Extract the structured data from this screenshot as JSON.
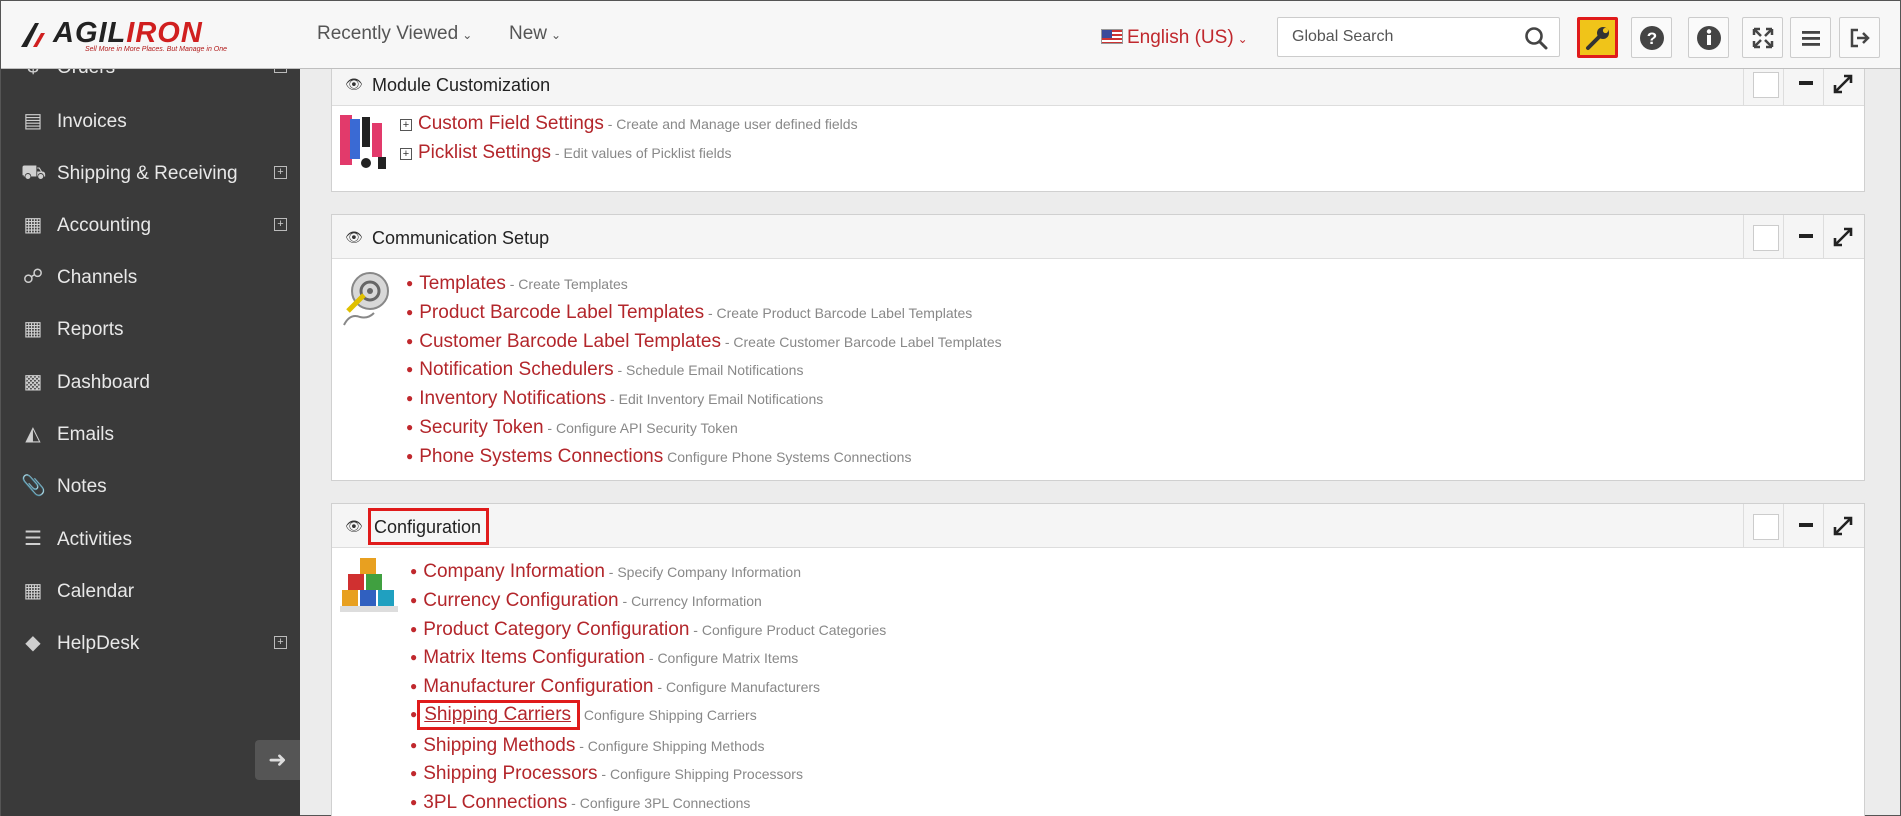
{
  "header": {
    "logo": {
      "word_black": "AGIL",
      "word_red": "IRON",
      "tagline": "Sell More in More Places. But Manage in One"
    },
    "nav": [
      {
        "label": "Recently Viewed"
      },
      {
        "label": "New"
      }
    ],
    "language": "English (US)",
    "search": {
      "placeholder": "Global Search",
      "value": ""
    },
    "toolbar_icons": [
      "wrench-icon",
      "help-icon",
      "info-icon",
      "fullscreen-icon",
      "menu-icon",
      "logout-icon"
    ],
    "active_icon": "wrench-icon"
  },
  "sidebar": {
    "items": [
      {
        "label": "Orders",
        "icon": "dollar-icon",
        "expandable": true
      },
      {
        "label": "Invoices",
        "icon": "document-icon",
        "expandable": false
      },
      {
        "label": "Shipping & Receiving",
        "icon": "truck-icon",
        "expandable": true
      },
      {
        "label": "Accounting",
        "icon": "book-icon",
        "expandable": true
      },
      {
        "label": "Channels",
        "icon": "channels-icon",
        "expandable": false
      },
      {
        "label": "Reports",
        "icon": "table-icon",
        "expandable": false
      },
      {
        "label": "Dashboard",
        "icon": "chart-icon",
        "expandable": false
      },
      {
        "label": "Emails",
        "icon": "inbox-icon",
        "expandable": false
      },
      {
        "label": "Notes",
        "icon": "paperclip-icon",
        "expandable": false
      },
      {
        "label": "Activities",
        "icon": "list-icon",
        "expandable": false
      },
      {
        "label": "Calendar",
        "icon": "calendar-icon",
        "expandable": false
      },
      {
        "label": "HelpDesk",
        "icon": "ticket-icon",
        "expandable": true
      }
    ],
    "plus_glyph": "+"
  },
  "panels": {
    "module_customization": {
      "title": "Module Customization",
      "items": [
        {
          "link": "Custom Field Settings",
          "desc": " - Create and Manage user defined fields"
        },
        {
          "link": "Picklist Settings",
          "desc": " - Edit values of Picklist fields"
        }
      ]
    },
    "communication_setup": {
      "title": "Communication Setup",
      "items": [
        {
          "link": "Templates",
          "desc": " - Create Templates"
        },
        {
          "link": "Product Barcode Label Templates",
          "desc": " - Create Product Barcode Label Templates"
        },
        {
          "link": "Customer Barcode Label Templates",
          "desc": " - Create Customer Barcode Label Templates"
        },
        {
          "link": "Notification Schedulers",
          "desc": " - Schedule Email Notifications"
        },
        {
          "link": "Inventory Notifications",
          "desc": " - Edit Inventory Email Notifications"
        },
        {
          "link": "Security Token",
          "desc": " - Configure API Security Token"
        },
        {
          "link": "Phone Systems Connections",
          "desc": " Configure Phone Systems Connections"
        }
      ]
    },
    "configuration": {
      "title": "Configuration",
      "items": [
        {
          "link": "Company Information",
          "desc": " - Specify Company Information"
        },
        {
          "link": "Currency Configuration",
          "desc": " - Currency Information"
        },
        {
          "link": "Product Category Configuration",
          "desc": " - Configure Product Categories"
        },
        {
          "link": "Matrix Items Configuration",
          "desc": " - Configure Matrix Items"
        },
        {
          "link": "Manufacturer Configuration",
          "desc": " - Configure Manufacturers"
        },
        {
          "link": "Shipping Carriers",
          "desc": " Configure Shipping Carriers"
        },
        {
          "link": "Shipping Methods",
          "desc": " - Configure Shipping Methods"
        },
        {
          "link": "Shipping Processors",
          "desc": " - Configure Shipping Processors"
        },
        {
          "link": "3PL Connections",
          "desc": " - Configure 3PL Connections"
        }
      ]
    }
  },
  "highlight_color": "#e01b1b",
  "link_color": "#b3262b"
}
